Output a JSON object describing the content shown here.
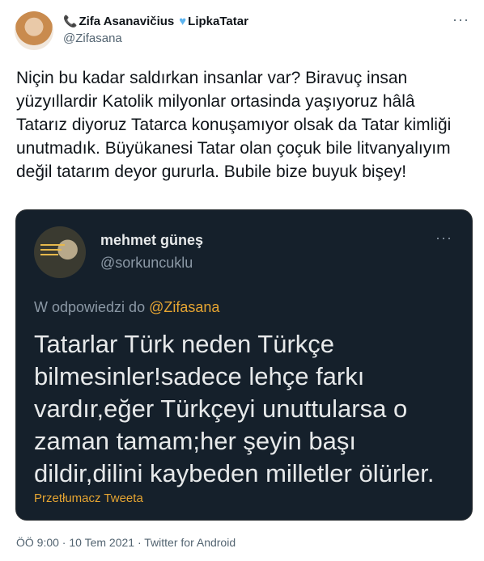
{
  "author": {
    "name_prefix_icon": "phone-icon",
    "display_name": "Zifa Asanavičius",
    "heart_icon": "blue-heart-icon",
    "name_suffix": "LipkaTatar",
    "handle": "@Zifasana"
  },
  "tweet_text": "Niçin bu kadar saldırkan insanlar var? Biravuç insan yüzyıllardir Katolik milyonlar ortasinda yaşıyoruz hâlâ Tatarız diyoruz Tatarca konuşamıyor olsak da Tatar kimliği unutmadık. Büyükanesi Tatar olan çoçuk bile litvanyalıyım değil tatarım deyor gururla. Bubile bize buyuk bişey!",
  "quoted_tweet": {
    "display_name": "mehmet güneş",
    "handle": "@sorkuncuklu",
    "reply_prefix": "W odpowiedzi do",
    "reply_mention": "@Zifasana",
    "text": "Tatarlar Türk neden Türkçe bilmesinler!sadece lehçe farkı vardır,eğer Türkçeyi unuttularsa o zaman tamam;her şeyin başı dildir,dilini kaybeden milletler ölürler.",
    "translate_label": "Przetłumacz Tweeta"
  },
  "meta": {
    "time": "ÖÖ 9:00",
    "date": "10 Tem 2021",
    "source": "Twitter for Android",
    "separator": " · "
  },
  "colors": {
    "quote_background": "#15202b",
    "quote_accent": "#e6a532",
    "heart": "#5db4f0"
  }
}
